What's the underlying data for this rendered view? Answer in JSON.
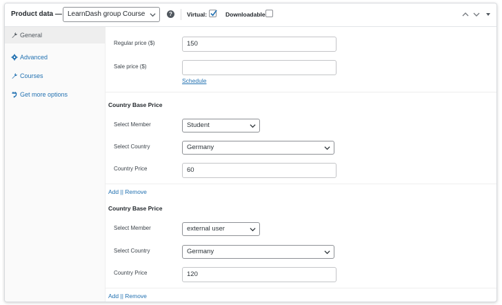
{
  "header": {
    "title": "Product data —",
    "product_type": "LearnDash group Course",
    "virtual_label": "Virtual:",
    "virtual_checked": true,
    "downloadable_label": "Downloadable:",
    "downloadable_checked": false,
    "icons": [
      "help-icon",
      "chevron-down-icon",
      "move-up-icon",
      "move-down-icon",
      "collapse-icon"
    ]
  },
  "tabs": [
    {
      "label": "General",
      "icon": "wrench-icon",
      "active": true
    },
    {
      "label": "Advanced",
      "icon": "gear-icon",
      "active": false
    },
    {
      "label": "Courses",
      "icon": "wrench-icon",
      "active": false
    },
    {
      "label": "Get more options",
      "icon": "plugin-icon",
      "active": false
    }
  ],
  "general": {
    "regular_price_label": "Regular price ($)",
    "regular_price_value": "150",
    "sale_price_label": "Sale price ($)",
    "sale_price_value": "",
    "schedule_link": "Schedule"
  },
  "country_base_price": [
    {
      "title": "Country Base Price",
      "member_label": "Select Member",
      "member_value": "Student",
      "country_label": "Select Country",
      "country_value": "Germany",
      "price_label": "Country Price",
      "price_value": "60",
      "actions": "Add || Remove"
    },
    {
      "title": "Country Base Price",
      "member_label": "Select Member",
      "member_value": "external user",
      "country_label": "Select Country",
      "country_value": "Germany",
      "price_label": "Country Price",
      "price_value": "120",
      "actions": "Add || Remove"
    }
  ],
  "colors": {
    "link": "#2271b1",
    "checkbox_check": "#2271b1",
    "sidebar_bg": "#fafafa",
    "active_tab_bg": "#eeeeee"
  }
}
